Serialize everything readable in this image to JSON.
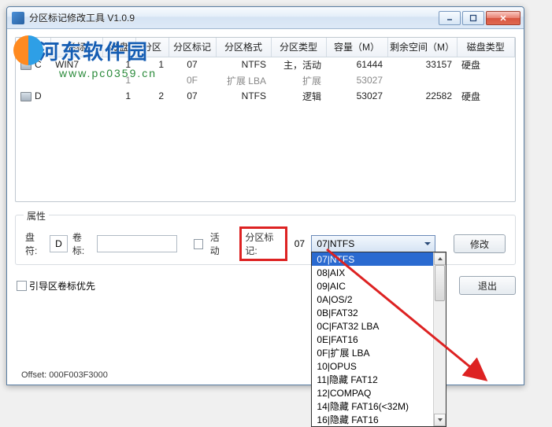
{
  "window": {
    "title": "分区标记修改工具  V1.0.9"
  },
  "watermark": {
    "brand": "河东软件园",
    "url": "www.pc0359.cn"
  },
  "table": {
    "headers": [
      "盘符",
      "卷标",
      "磁盘",
      "分区",
      "分区标记",
      "分区格式",
      "分区类型",
      "容量（M）",
      "剩余空间（M）",
      "磁盘类型"
    ],
    "rows": [
      {
        "drive": "C",
        "label": "WIN7",
        "disk": "1",
        "part": "1",
        "mark": "07",
        "fmt": "NTFS",
        "ptype": "主，活动",
        "cap": "61444",
        "free": "33157",
        "dtype": "硬盘"
      },
      {
        "drive": "",
        "label": "",
        "disk": "1",
        "part": "",
        "mark": "0F",
        "fmt": "扩展 LBA",
        "ptype": "扩展",
        "cap": "53027",
        "free": "",
        "dtype": "",
        "dim": true
      },
      {
        "drive": "D",
        "label": "",
        "disk": "1",
        "part": "2",
        "mark": "07",
        "fmt": "NTFS",
        "ptype": "逻辑",
        "cap": "53027",
        "free": "22582",
        "dtype": "硬盘"
      }
    ]
  },
  "props": {
    "group_title": "属性",
    "drive_label": "盘符:",
    "drive_value": "D",
    "vol_label": "卷标:",
    "vol_value": "",
    "active_label": "活动",
    "mark_label": "分区标记:",
    "mark_value": "07",
    "combo_selected": "07|NTFS",
    "combo_items": [
      "07|NTFS",
      "08|AIX",
      "09|AIC",
      "0A|OS/2",
      "0B|FAT32",
      "0C|FAT32 LBA",
      "0E|FAT16",
      "0F|扩展 LBA",
      "10|OPUS",
      "11|隐藏 FAT12",
      "12|COMPAQ",
      "14|隐藏 FAT16(<32M)",
      "16|隐藏 FAT16"
    ],
    "modify_btn": "修改"
  },
  "footer": {
    "boot_priority_label": "引导区卷标优先",
    "exit_btn": "退出"
  },
  "status": {
    "offset": "Offset:  000F003F3000"
  }
}
